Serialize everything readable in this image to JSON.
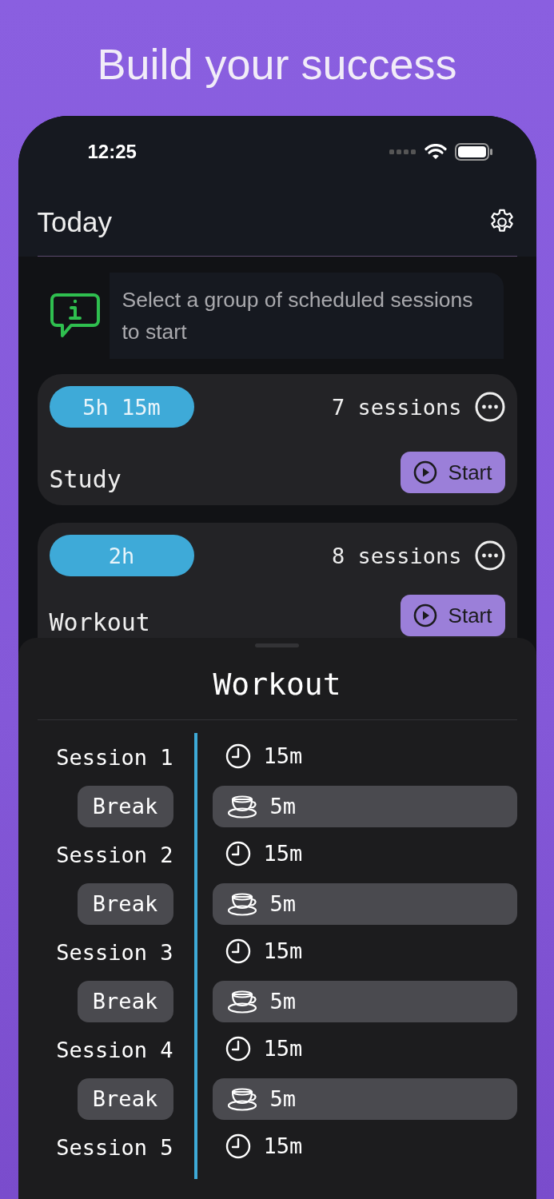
{
  "headline": "Build your success",
  "status_bar": {
    "time": "12:25"
  },
  "header": {
    "title": "Today"
  },
  "info": {
    "text": "Select a group of scheduled sessions to start"
  },
  "groups": [
    {
      "duration": "5h 15m",
      "sessions": "7 sessions",
      "name": "Study",
      "start": "Start"
    },
    {
      "duration": "2h",
      "sessions": "8 sessions",
      "name": "Workout",
      "start": "Start"
    }
  ],
  "sheet": {
    "title": "Workout",
    "timeline": [
      {
        "kind": "session",
        "label": "Session 1",
        "duration": "15m"
      },
      {
        "kind": "break",
        "label": "Break",
        "duration": "5m"
      },
      {
        "kind": "session",
        "label": "Session 2",
        "duration": "15m"
      },
      {
        "kind": "break",
        "label": "Break",
        "duration": "5m"
      },
      {
        "kind": "session",
        "label": "Session 3",
        "duration": "15m"
      },
      {
        "kind": "break",
        "label": "Break",
        "duration": "5m"
      },
      {
        "kind": "session",
        "label": "Session 4",
        "duration": "15m"
      },
      {
        "kind": "break",
        "label": "Break",
        "duration": "5m"
      },
      {
        "kind": "session",
        "label": "Session 5",
        "duration": "15m"
      }
    ]
  }
}
